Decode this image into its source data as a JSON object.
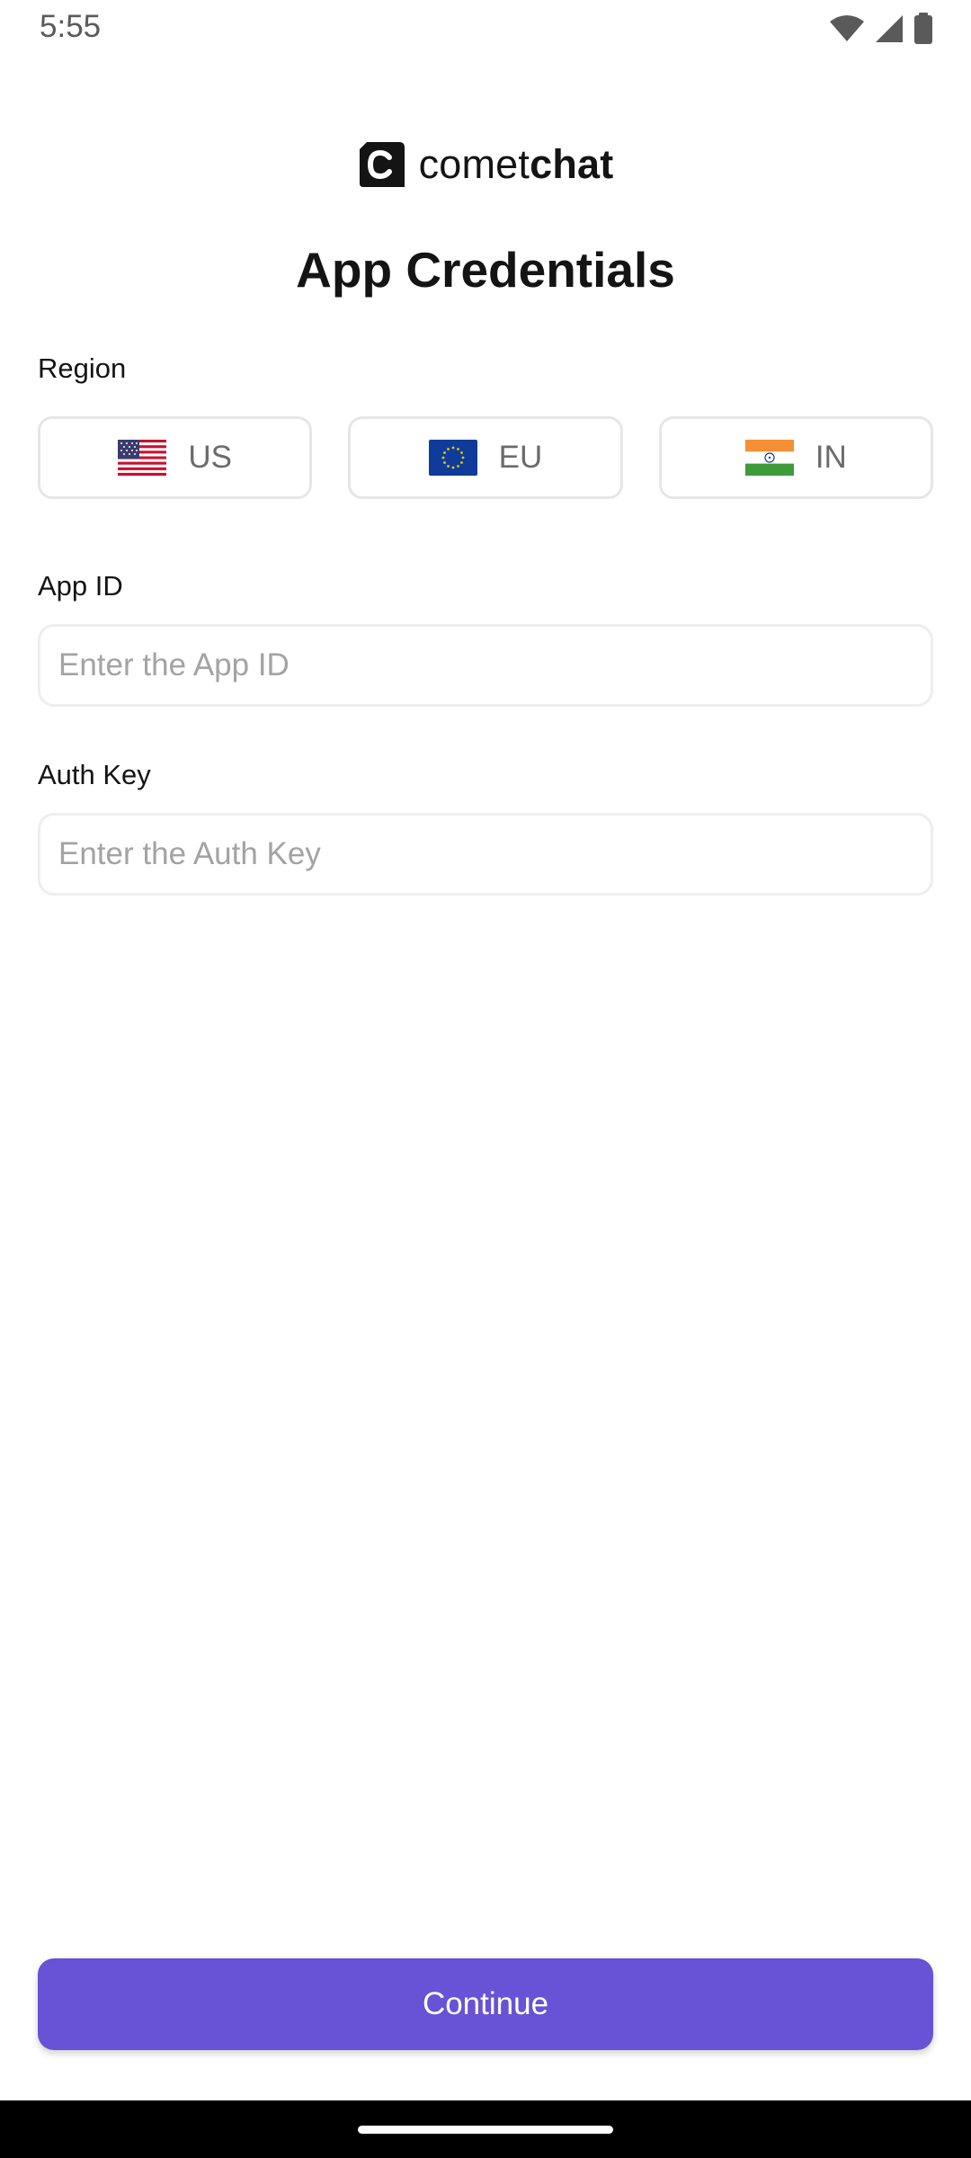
{
  "status_bar": {
    "time": "5:55",
    "icons": [
      "wifi-icon",
      "cell-signal-icon",
      "battery-icon"
    ]
  },
  "logo": {
    "text_regular": "comet",
    "text_bold": "chat"
  },
  "title": "App Credentials",
  "region": {
    "label": "Region",
    "options": [
      {
        "code": "US",
        "flag": "us-flag-icon"
      },
      {
        "code": "EU",
        "flag": "eu-flag-icon"
      },
      {
        "code": "IN",
        "flag": "in-flag-icon"
      }
    ]
  },
  "app_id": {
    "label": "App ID",
    "value": "",
    "placeholder": "Enter the App ID"
  },
  "auth_key": {
    "label": "Auth Key",
    "value": "",
    "placeholder": "Enter the Auth Key"
  },
  "continue_label": "Continue",
  "colors": {
    "accent": "#6852d6",
    "text": "#141414",
    "placeholder": "#a3a3a3",
    "border": "#e6e6e6"
  }
}
